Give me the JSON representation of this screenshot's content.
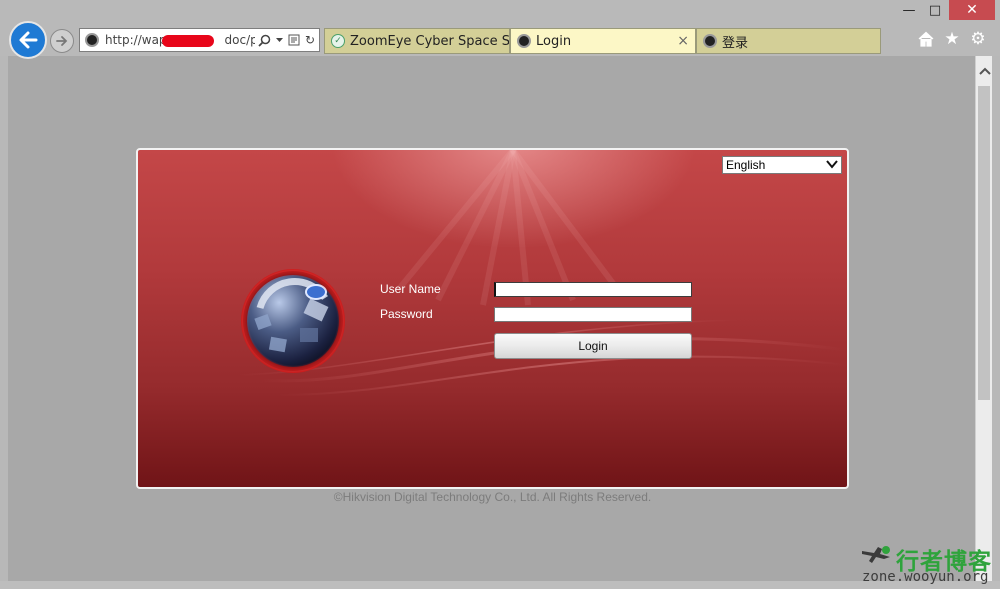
{
  "window": {
    "minimize_glyph": "—",
    "maximize_glyph": "□",
    "close_glyph": "✕"
  },
  "address_bar": {
    "url_prefix": "http://wap",
    "url_suffix": "doc/pa",
    "refresh_glyph": "↻"
  },
  "tabs": [
    {
      "label": "ZoomEye Cyber Space Se...",
      "icon": "zoomeye-icon",
      "active": false
    },
    {
      "label": "Login",
      "icon": "camera-icon",
      "active": true,
      "close_glyph": "×"
    },
    {
      "label": "登录",
      "icon": "camera-icon",
      "active": false
    }
  ],
  "nav_icons": [
    "home-icon",
    "favorites-star-icon",
    "settings-gear-icon"
  ],
  "login": {
    "language": "English",
    "username_label": "User Name",
    "password_label": "Password",
    "login_button": "Login",
    "copyright": "©Hikvision Digital Technology Co., Ltd. All Rights Reserved."
  },
  "watermark": {
    "title": "行者博客",
    "url": "zone.wooyun.org"
  },
  "colors": {
    "panel_red": "#b23a3c",
    "tab_active": "#fcf7c6",
    "tab_inactive": "#d3cf97",
    "back_button": "#1f7ad4",
    "watermark_green": "#2fa33c"
  }
}
